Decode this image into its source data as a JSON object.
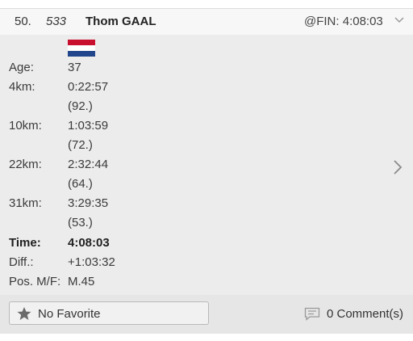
{
  "header": {
    "rank": "50.",
    "bib": "533",
    "name": "Thom GAAL",
    "finish": "@FIN: 4:08:03"
  },
  "flag": {
    "country_colors": [
      "#c8102e",
      "#ffffff",
      "#21468b"
    ]
  },
  "details": {
    "age_label": "Age:",
    "age_value": "37",
    "splits": [
      {
        "label": "4km:",
        "time": "0:22:57",
        "rank": "(92.)"
      },
      {
        "label": "10km:",
        "time": "1:03:59",
        "rank": "(72.)"
      },
      {
        "label": "22km:",
        "time": "2:32:44",
        "rank": "(64.)"
      },
      {
        "label": "31km:",
        "time": "3:29:35",
        "rank": "(53.)"
      }
    ],
    "time_label": "Time:",
    "time_value": "4:08:03",
    "diff_label": "Diff.:",
    "diff_value": "+1:03:32",
    "pos_label": "Pos. M/F:",
    "pos_value": "M.45"
  },
  "footer": {
    "favorite_label": "No Favorite",
    "comments_label": "0 Comment(s)"
  },
  "icons": {
    "expand": "chevron-down-icon",
    "detail": "chevron-right-icon",
    "favorite": "star-icon",
    "comment": "comment-icon"
  }
}
